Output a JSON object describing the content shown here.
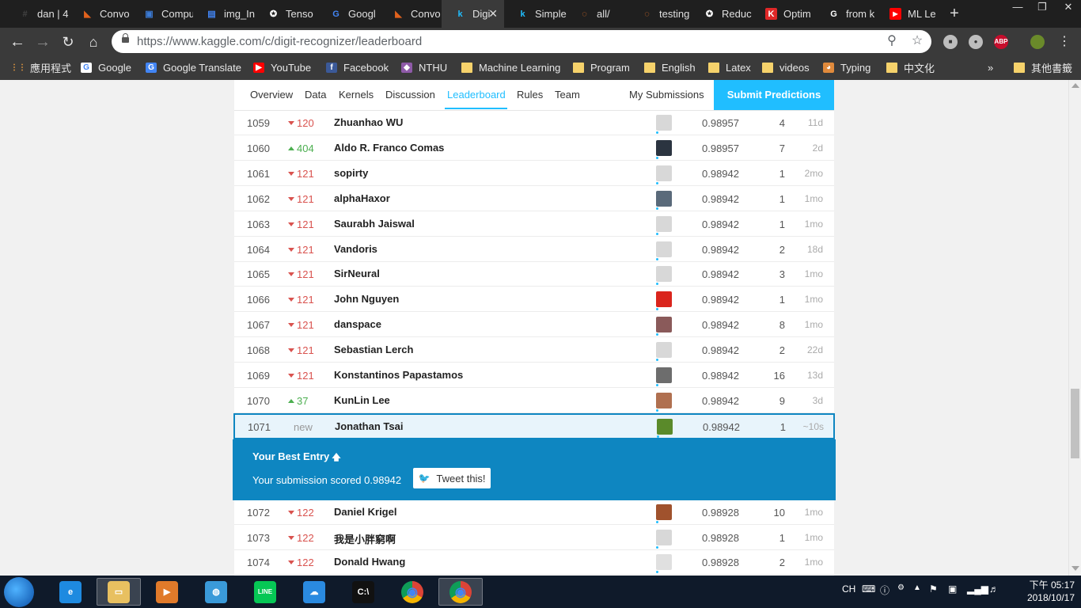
{
  "browser": {
    "tabs": [
      {
        "label": "dan | 4",
        "icon": "hash-icon",
        "color": "#444444"
      },
      {
        "label": "Convo",
        "icon": "matlab-icon",
        "color": "#e1621d"
      },
      {
        "label": "Compu",
        "icon": "chip-icon",
        "color": "#3b7bd6"
      },
      {
        "label": "img_In",
        "icon": "docs-icon",
        "color": "#4285f4"
      },
      {
        "label": "Tenso",
        "icon": "compass-icon",
        "color": "#ffffff"
      },
      {
        "label": "Googl",
        "icon": "translate-icon",
        "color": "#4285f4"
      },
      {
        "label": "Convo",
        "icon": "matlab-icon",
        "color": "#e1621d"
      },
      {
        "label": "Digi",
        "icon": "kaggle-icon",
        "color": "#20beff"
      },
      {
        "label": "Simple",
        "icon": "kaggle-icon",
        "color": "#20beff"
      },
      {
        "label": "all/",
        "icon": "jupyter-icon",
        "color": "#f37726"
      },
      {
        "label": "testing",
        "icon": "jupyter-icon",
        "color": "#f37726"
      },
      {
        "label": "Reduc",
        "icon": "compass-icon",
        "color": "#ffffff"
      },
      {
        "label": "Optim",
        "icon": "k-red-icon",
        "color": "#e02828"
      },
      {
        "label": "from k",
        "icon": "google-icon",
        "color": "#ffffff"
      },
      {
        "label": "ML Le",
        "icon": "youtube-icon",
        "color": "#ff0000"
      }
    ],
    "url": "https://www.kaggle.com/c/digit-recognizer/leaderboard",
    "bookmarks": [
      {
        "label": "應用程式",
        "icon": "apps-grid-icon"
      },
      {
        "label": "Google",
        "icon": "google-icon"
      },
      {
        "label": "Google Translate",
        "icon": "translate-icon"
      },
      {
        "label": "YouTube",
        "icon": "youtube-icon"
      },
      {
        "label": "Facebook",
        "icon": "facebook-icon"
      },
      {
        "label": "NTHU",
        "icon": "nthu-icon"
      },
      {
        "label": "Machine Learning",
        "icon": "folder-icon"
      },
      {
        "label": "Program",
        "icon": "folder-icon"
      },
      {
        "label": "English",
        "icon": "folder-icon"
      },
      {
        "label": "Latex",
        "icon": "folder-icon"
      },
      {
        "label": "videos",
        "icon": "folder-icon"
      },
      {
        "label": "Typing",
        "icon": "typing-icon"
      },
      {
        "label": "中文化",
        "icon": "folder-icon"
      }
    ],
    "bookmarks_more": "»",
    "other_bookmarks": "其他書籤",
    "extensions": [
      "ABP"
    ]
  },
  "competition_nav": {
    "items": [
      "Overview",
      "Data",
      "Kernels",
      "Discussion",
      "Leaderboard",
      "Rules",
      "Team"
    ],
    "active": "Leaderboard",
    "my_submissions": "My Submissions",
    "submit": "Submit Predictions",
    "accent": "#20beff"
  },
  "leaderboard": {
    "rows_before": [
      {
        "rank": "1059",
        "dir": "down",
        "change": "120",
        "team": "Zhuanhao WU",
        "score": "0.98957",
        "entries": "4",
        "last": "11d",
        "avatar": "#d8d8d8"
      },
      {
        "rank": "1060",
        "dir": "up",
        "change": "404",
        "team": "Aldo R. Franco Comas",
        "score": "0.98957",
        "entries": "7",
        "last": "2d",
        "avatar": "#2b3440"
      },
      {
        "rank": "1061",
        "dir": "down",
        "change": "121",
        "team": "sopirty",
        "score": "0.98942",
        "entries": "1",
        "last": "2mo",
        "avatar": "#d8d8d8"
      },
      {
        "rank": "1062",
        "dir": "down",
        "change": "121",
        "team": "alphaHaxor",
        "score": "0.98942",
        "entries": "1",
        "last": "1mo",
        "avatar": "#5a6a7a"
      },
      {
        "rank": "1063",
        "dir": "down",
        "change": "121",
        "team": "Saurabh Jaiswal",
        "score": "0.98942",
        "entries": "1",
        "last": "1mo",
        "avatar": "#d8d8d8"
      },
      {
        "rank": "1064",
        "dir": "down",
        "change": "121",
        "team": "Vandoris",
        "score": "0.98942",
        "entries": "2",
        "last": "18d",
        "avatar": "#d8d8d8"
      },
      {
        "rank": "1065",
        "dir": "down",
        "change": "121",
        "team": "SirNeural",
        "score": "0.98942",
        "entries": "3",
        "last": "1mo",
        "avatar": "#d8d8d8"
      },
      {
        "rank": "1066",
        "dir": "down",
        "change": "121",
        "team": "John Nguyen",
        "score": "0.98942",
        "entries": "1",
        "last": "1mo",
        "avatar": "#da251d"
      },
      {
        "rank": "1067",
        "dir": "down",
        "change": "121",
        "team": "danspace",
        "score": "0.98942",
        "entries": "8",
        "last": "1mo",
        "avatar": "#8a5a5a"
      },
      {
        "rank": "1068",
        "dir": "down",
        "change": "121",
        "team": "Sebastian Lerch",
        "score": "0.98942",
        "entries": "2",
        "last": "22d",
        "avatar": "#d8d8d8"
      },
      {
        "rank": "1069",
        "dir": "down",
        "change": "121",
        "team": "Konstantinos Papastamos",
        "score": "0.98942",
        "entries": "16",
        "last": "13d",
        "avatar": "#6d6d6d"
      },
      {
        "rank": "1070",
        "dir": "up",
        "change": "37",
        "team": "KunLin Lee",
        "score": "0.98942",
        "entries": "9",
        "last": "3d",
        "avatar": "#b07050"
      }
    ],
    "my_row": {
      "rank": "1071",
      "dir": "new",
      "change": "new",
      "team": "Jonathan Tsai",
      "score": "0.98942",
      "entries": "1",
      "last": "~10s",
      "avatar": "#5a8a2a"
    },
    "best_entry": {
      "title": "Your Best Entry",
      "message": "Your submission scored 0.98942",
      "tweet": "Tweet this!",
      "color": "#0e86c1"
    },
    "rows_after": [
      {
        "rank": "1072",
        "dir": "down",
        "change": "122",
        "team": "Daniel Krigel",
        "score": "0.98928",
        "entries": "10",
        "last": "1mo",
        "avatar": "#a0522d"
      },
      {
        "rank": "1073",
        "dir": "down",
        "change": "122",
        "team": "我是小胖窮啊",
        "score": "0.98928",
        "entries": "1",
        "last": "1mo",
        "avatar": "#d8d8d8"
      },
      {
        "rank": "1074",
        "dir": "down",
        "change": "122",
        "team": "Donald Hwang",
        "score": "0.98928",
        "entries": "2",
        "last": "1mo",
        "avatar": "#e0e0e0"
      }
    ]
  },
  "taskbar": {
    "apps": [
      "ie-icon",
      "explorer-icon",
      "media-player-icon",
      "network-globe-icon",
      "line-icon",
      "baidu-cloud-icon",
      "cmd-icon",
      "chrome-icon",
      "chrome-icon"
    ],
    "ime": "CH",
    "time": "下午 05:17",
    "date": "2018/10/17"
  }
}
